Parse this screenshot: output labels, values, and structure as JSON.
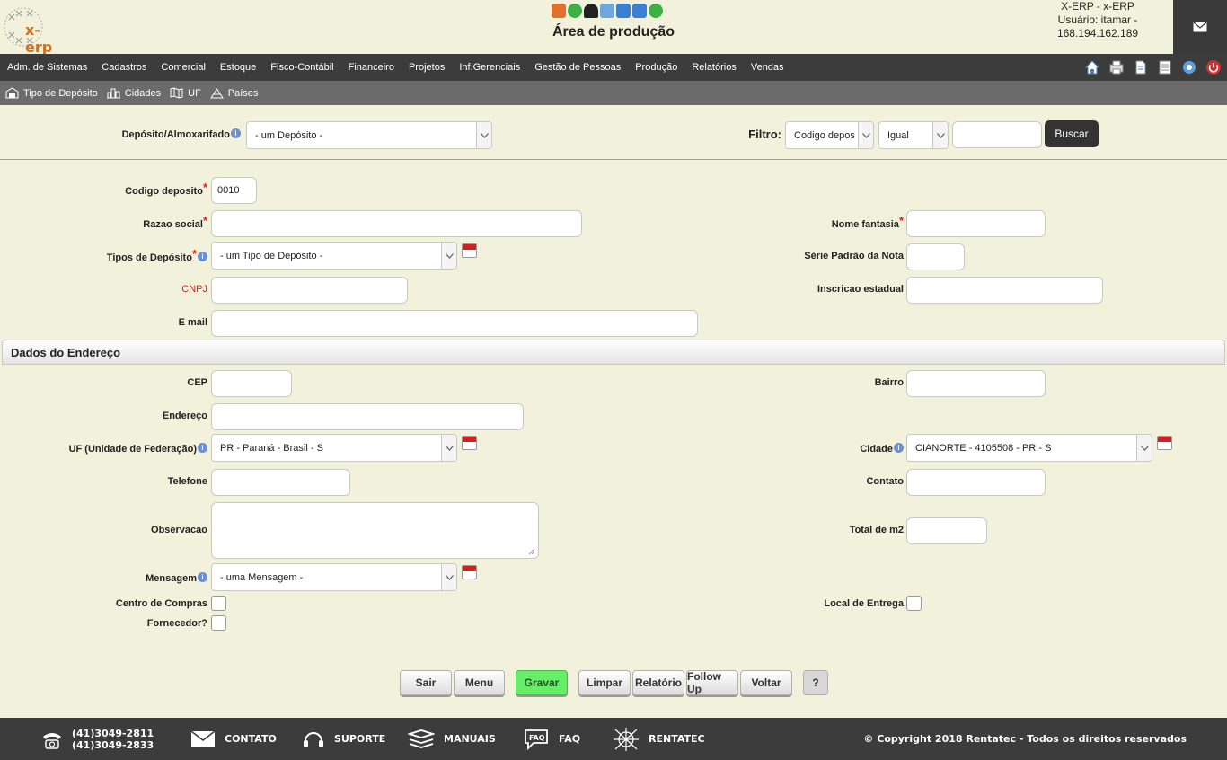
{
  "header": {
    "logo_text": "x-erp",
    "title": "Área de produção",
    "user_line1": "X-ERP - x-ERP",
    "user_line2": "Usuário: itamar -",
    "user_line3": "168.194.162.189"
  },
  "menu": [
    "Adm. de Sistemas",
    "Cadastros",
    "Comercial",
    "Estoque",
    "Fisco-Contábil",
    "Financeiro",
    "Projetos",
    "Inf.Gerenciais",
    "Gestão de Pessoas",
    "Produção",
    "Relatórios",
    "Vendas"
  ],
  "submenu": [
    "Tipo de Depósito",
    "Cidades",
    "UF",
    "Países"
  ],
  "filter": {
    "deposito_label": "Depósito/Almoxarifado",
    "deposito_value": "- um Depósito -",
    "filtro_label": "Filtro:",
    "campo_value": "Codigo depos",
    "operador_value": "Igual",
    "buscar_label": "Buscar"
  },
  "form": {
    "codigo_label": "Codigo deposito",
    "codigo_value": "0010",
    "razao_label": "Razao social",
    "nome_fantasia_label": "Nome fantasia",
    "tipos_label": "Tipos de Depósito",
    "tipos_value": "- um Tipo de Depósito -",
    "serie_label": "Série Padrão da Nota",
    "cnpj_label": "CNPJ",
    "inscricao_label": "Inscricao estadual",
    "email_label": "E mail",
    "section_title": "Dados do Endereço",
    "cep_label": "CEP",
    "bairro_label": "Bairro",
    "endereco_label": "Endereço",
    "uf_label": "UF (Unidade de Federação)",
    "uf_value": "PR - Paraná - Brasil - S",
    "cidade_label": "Cidade",
    "cidade_value": "CIANORTE - 4105508 - PR - S",
    "telefone_label": "Telefone",
    "contato_label": "Contato",
    "observacao_label": "Observacao",
    "total_m2_label": "Total de m2",
    "mensagem_label": "Mensagem",
    "mensagem_value": "- uma Mensagem -",
    "centro_label": "Centro de Compras",
    "local_entrega_label": "Local de Entrega",
    "fornecedor_label": "Fornecedor?"
  },
  "buttons": {
    "sair": "Sair",
    "menu": "Menu",
    "gravar": "Gravar",
    "limpar": "Limpar",
    "relatorio": "Relatório",
    "followup": "Follow Up",
    "voltar": "Voltar",
    "help": "?"
  },
  "footer": {
    "phone1": "(41)3049-2811",
    "phone2": "(41)3049-2833",
    "contato": "CONTATO",
    "suporte": "SUPORTE",
    "manuais": "MANUAIS",
    "faq": "FAQ",
    "rentatec": "RENTATEC",
    "copyright": "© Copyright 2018 Rentatec - Todos os direitos reservados"
  },
  "colors": {
    "background": "#f2f2dc",
    "menubar": "#3c3c3c",
    "submenu": "#6b6b6b",
    "gravar": "#66ee66",
    "required": "#e02020"
  }
}
